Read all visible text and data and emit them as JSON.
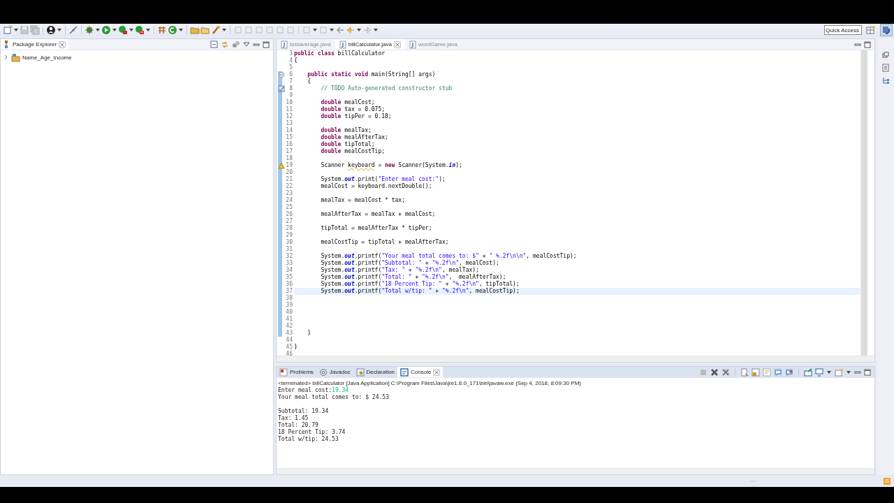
{
  "toolbar": {
    "quick_access": {
      "placeholder": "Quick Access"
    }
  },
  "package_explorer": {
    "title": "Package Explorer",
    "items": [
      {
        "label": "Name_Age_Income",
        "expanded": false
      }
    ]
  },
  "editor": {
    "tabs": [
      {
        "label": "testaverage.java",
        "selected": false
      },
      {
        "label": "billCalculator.java",
        "selected": true
      },
      {
        "label": "wordGame.java",
        "selected": false
      }
    ],
    "lines": [
      {
        "number": "3",
        "changed": false,
        "current": false,
        "tokens": [
          {
            "kind": "keyword",
            "text": "public class"
          },
          {
            "kind": "plain",
            "text": " billCalculator"
          }
        ]
      },
      {
        "number": "4",
        "changed": false,
        "current": false,
        "tokens": [
          {
            "kind": "plain",
            "text": "{"
          }
        ]
      },
      {
        "number": "5",
        "changed": false,
        "current": false
      },
      {
        "number": "6",
        "changed": true,
        "current": false,
        "gutter_mark": {
          "kind": "fold"
        },
        "tokens": [
          {
            "kind": "keyword",
            "text": "    public static void"
          },
          {
            "kind": "plain",
            "text": " main(String[] args)"
          }
        ]
      },
      {
        "number": "7",
        "changed": true,
        "current": false,
        "tokens": [
          {
            "kind": "plain",
            "text": "    {"
          }
        ]
      },
      {
        "number": "8",
        "changed": true,
        "current": false,
        "gutter_mark": {
          "kind": "task"
        },
        "tokens": [
          {
            "kind": "comment",
            "text": "        // TODO Auto-generated constructor stub"
          }
        ]
      },
      {
        "number": "9",
        "changed": true,
        "current": false
      },
      {
        "number": "10",
        "changed": true,
        "current": false,
        "tokens": [
          {
            "kind": "keyword",
            "text": "        double"
          },
          {
            "kind": "plain",
            "text": " mealCost;"
          }
        ]
      },
      {
        "number": "11",
        "changed": true,
        "current": false,
        "tokens": [
          {
            "kind": "keyword",
            "text": "        double"
          },
          {
            "kind": "plain",
            "text": " tax = 0.075;"
          }
        ]
      },
      {
        "number": "12",
        "changed": true,
        "current": false,
        "tokens": [
          {
            "kind": "keyword",
            "text": "        double"
          },
          {
            "kind": "plain",
            "text": " tipPer = 0.18;"
          }
        ]
      },
      {
        "number": "13",
        "changed": true,
        "current": false
      },
      {
        "number": "14",
        "changed": true,
        "current": false,
        "tokens": [
          {
            "kind": "keyword",
            "text": "        double"
          },
          {
            "kind": "plain",
            "text": " mealTax;"
          }
        ]
      },
      {
        "number": "15",
        "changed": true,
        "current": false,
        "tokens": [
          {
            "kind": "keyword",
            "text": "        double"
          },
          {
            "kind": "plain",
            "text": " mealAfterTax;"
          }
        ]
      },
      {
        "number": "16",
        "changed": true,
        "current": false,
        "tokens": [
          {
            "kind": "keyword",
            "text": "        double"
          },
          {
            "kind": "plain",
            "text": " tipTotal;"
          }
        ]
      },
      {
        "number": "17",
        "changed": true,
        "current": false,
        "tokens": [
          {
            "kind": "keyword",
            "text": "        double"
          },
          {
            "kind": "plain",
            "text": " mealCostTip;"
          }
        ]
      },
      {
        "number": "18",
        "changed": true,
        "current": false
      },
      {
        "number": "19",
        "changed": true,
        "current": false,
        "gutter_mark": {
          "kind": "warning"
        },
        "tokens": [
          {
            "kind": "plain",
            "text": "        Scanner "
          },
          {
            "kind": "warning",
            "text": "keyboard"
          },
          {
            "kind": "plain",
            "text": " = "
          },
          {
            "kind": "keyword",
            "text": "new"
          },
          {
            "kind": "plain",
            "text": " Scanner(System."
          },
          {
            "kind": "field",
            "text": "in"
          },
          {
            "kind": "plain",
            "text": ");"
          }
        ]
      },
      {
        "number": "20",
        "changed": true,
        "current": false
      },
      {
        "number": "21",
        "changed": true,
        "current": false,
        "tokens": [
          {
            "kind": "plain",
            "text": "        System."
          },
          {
            "kind": "field",
            "text": "out"
          },
          {
            "kind": "plain",
            "text": ".print("
          },
          {
            "kind": "string",
            "text": "\"Enter meal cost:\""
          },
          {
            "kind": "plain",
            "text": ");"
          }
        ]
      },
      {
        "number": "22",
        "changed": true,
        "current": false,
        "tokens": [
          {
            "kind": "plain",
            "text": "        mealCost = keyboard.nextDouble();"
          }
        ]
      },
      {
        "number": "23",
        "changed": true,
        "current": false
      },
      {
        "number": "24",
        "changed": true,
        "current": false,
        "tokens": [
          {
            "kind": "plain",
            "text": "        mealTax = mealCost * tax;"
          }
        ]
      },
      {
        "number": "25",
        "changed": true,
        "current": false
      },
      {
        "number": "26",
        "changed": true,
        "current": false,
        "tokens": [
          {
            "kind": "plain",
            "text": "        mealAfterTax = mealTax + mealCost;"
          }
        ]
      },
      {
        "number": "27",
        "changed": true,
        "current": false
      },
      {
        "number": "28",
        "changed": true,
        "current": false,
        "tokens": [
          {
            "kind": "plain",
            "text": "        tipTotal = mealAfterTax * tipPer;"
          }
        ]
      },
      {
        "number": "29",
        "changed": true,
        "current": false
      },
      {
        "number": "30",
        "changed": true,
        "current": false,
        "tokens": [
          {
            "kind": "plain",
            "text": "        mealCostTip = tipTotal + mealAfterTax;"
          }
        ]
      },
      {
        "number": "31",
        "changed": true,
        "current": false
      },
      {
        "number": "32",
        "changed": true,
        "current": false,
        "tokens": [
          {
            "kind": "plain",
            "text": "        System."
          },
          {
            "kind": "field",
            "text": "out"
          },
          {
            "kind": "plain",
            "text": ".printf("
          },
          {
            "kind": "string",
            "text": "\"Your meal total comes to: $\""
          },
          {
            "kind": "plain",
            "text": " + "
          },
          {
            "kind": "string",
            "text": "\" %.2f\\n\\n\""
          },
          {
            "kind": "plain",
            "text": ", mealCostTip);"
          }
        ]
      },
      {
        "number": "33",
        "changed": true,
        "current": false,
        "tokens": [
          {
            "kind": "plain",
            "text": "        System."
          },
          {
            "kind": "field",
            "text": "out"
          },
          {
            "kind": "plain",
            "text": ".printf("
          },
          {
            "kind": "string",
            "text": "\"Subtotal: \""
          },
          {
            "kind": "plain",
            "text": " + "
          },
          {
            "kind": "string",
            "text": "\"%.2f\\n\""
          },
          {
            "kind": "plain",
            "text": ", mealCost);"
          }
        ]
      },
      {
        "number": "34",
        "changed": true,
        "current": false,
        "tokens": [
          {
            "kind": "plain",
            "text": "        System."
          },
          {
            "kind": "field",
            "text": "out"
          },
          {
            "kind": "plain",
            "text": ".printf("
          },
          {
            "kind": "string",
            "text": "\"Tax: \""
          },
          {
            "kind": "plain",
            "text": " + "
          },
          {
            "kind": "string",
            "text": "\"%.2f\\n\""
          },
          {
            "kind": "plain",
            "text": ", mealTax);"
          }
        ]
      },
      {
        "number": "35",
        "changed": true,
        "current": false,
        "tokens": [
          {
            "kind": "plain",
            "text": "        System."
          },
          {
            "kind": "field",
            "text": "out"
          },
          {
            "kind": "plain",
            "text": ".printf("
          },
          {
            "kind": "string",
            "text": "\"Total: \""
          },
          {
            "kind": "plain",
            "text": " + "
          },
          {
            "kind": "string",
            "text": "\"%.2f\\n\""
          },
          {
            "kind": "plain",
            "text": ",  mealAfterTax);"
          }
        ]
      },
      {
        "number": "36",
        "changed": true,
        "current": false,
        "tokens": [
          {
            "kind": "plain",
            "text": "        System."
          },
          {
            "kind": "field",
            "text": "out"
          },
          {
            "kind": "plain",
            "text": ".printf("
          },
          {
            "kind": "string",
            "text": "\"18 Percent Tip: \""
          },
          {
            "kind": "plain",
            "text": " + "
          },
          {
            "kind": "string",
            "text": "\"%.2f\\n\""
          },
          {
            "kind": "plain",
            "text": ", tipTotal);"
          }
        ]
      },
      {
        "number": "37",
        "changed": true,
        "current": true,
        "tokens": [
          {
            "kind": "plain",
            "text": "        System."
          },
          {
            "kind": "field",
            "text": "out"
          },
          {
            "kind": "plain",
            "text": ".printf("
          },
          {
            "kind": "string",
            "text": "\"Total w/tip: \""
          },
          {
            "kind": "plain",
            "text": " + "
          },
          {
            "kind": "string",
            "text": "\"%.2f\\n\""
          },
          {
            "kind": "plain",
            "text": ", mealCostTip);"
          }
        ]
      },
      {
        "number": "38",
        "changed": true,
        "current": false
      },
      {
        "number": "39",
        "changed": true,
        "current": false
      },
      {
        "number": "40",
        "changed": true,
        "current": false
      },
      {
        "number": "41",
        "changed": true,
        "current": false
      },
      {
        "number": "42",
        "changed": true,
        "current": false
      },
      {
        "number": "43",
        "changed": true,
        "current": false,
        "tokens": [
          {
            "kind": "plain",
            "text": "    }"
          }
        ]
      },
      {
        "number": "44",
        "changed": false,
        "current": false
      },
      {
        "number": "45",
        "changed": false,
        "current": false,
        "tokens": [
          {
            "kind": "plain",
            "text": "}"
          }
        ]
      },
      {
        "number": "46",
        "changed": false,
        "current": false
      }
    ]
  },
  "console": {
    "tabs": [
      {
        "label": "Problems",
        "selected": false
      },
      {
        "label": "Javadoc",
        "selected": false
      },
      {
        "label": "Declaration",
        "selected": false
      },
      {
        "label": "Console",
        "selected": true
      }
    ],
    "status": "<terminated> billCalculator [Java Application] C:\\Program Files\\Java\\jre1.8.0_171\\bin\\javaw.exe (Sep 4, 2018, 8:09:30 PM)",
    "output": [
      {
        "kind": "text",
        "tokens": [
          {
            "kind": "output",
            "text": "Enter meal cost:"
          },
          {
            "kind": "input",
            "text": "19.34"
          }
        ]
      },
      {
        "kind": "text",
        "tokens": [
          {
            "kind": "output",
            "text": "Your meal total comes to: $ 24.53"
          }
        ]
      },
      {
        "kind": "blank"
      },
      {
        "kind": "text",
        "tokens": [
          {
            "kind": "output",
            "text": "Subtotal: 19.34"
          }
        ]
      },
      {
        "kind": "text",
        "tokens": [
          {
            "kind": "output",
            "text": "Tax: 1.45"
          }
        ]
      },
      {
        "kind": "text",
        "tokens": [
          {
            "kind": "output",
            "text": "Total: 20.79"
          }
        ]
      },
      {
        "kind": "text",
        "tokens": [
          {
            "kind": "output",
            "text": "18 Percent Tip: 3.74"
          }
        ]
      },
      {
        "kind": "text",
        "tokens": [
          {
            "kind": "output",
            "text": "Total w/tip: 24.53"
          }
        ]
      }
    ]
  }
}
